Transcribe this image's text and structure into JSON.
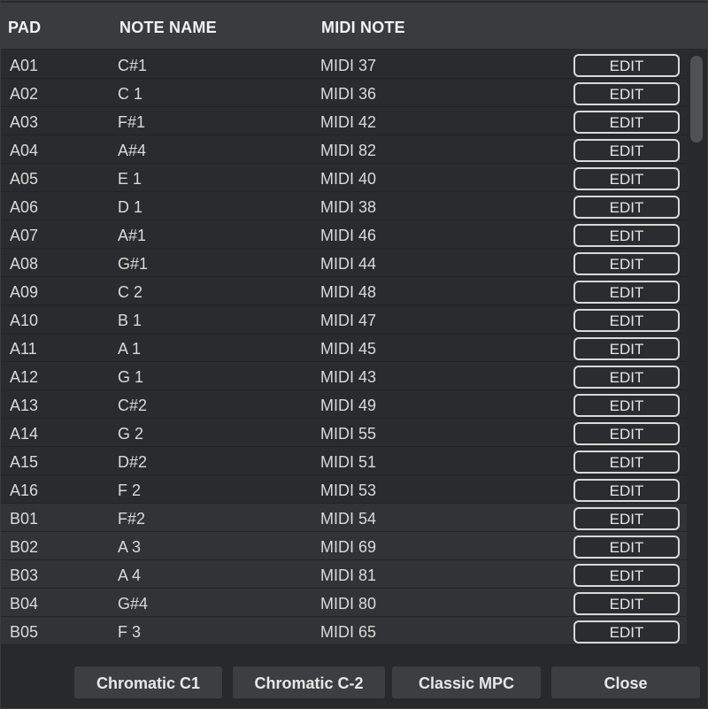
{
  "header": {
    "pad_label": "PAD",
    "note_name_label": "NOTE NAME",
    "midi_note_label": "MIDI NOTE"
  },
  "edit_label": "EDIT",
  "rows": [
    {
      "pad": "A01",
      "note": "C#1",
      "midi": "MIDI 37"
    },
    {
      "pad": "A02",
      "note": "C 1",
      "midi": "MIDI 36"
    },
    {
      "pad": "A03",
      "note": "F#1",
      "midi": "MIDI 42"
    },
    {
      "pad": "A04",
      "note": "A#4",
      "midi": "MIDI 82"
    },
    {
      "pad": "A05",
      "note": "E 1",
      "midi": "MIDI 40"
    },
    {
      "pad": "A06",
      "note": "D 1",
      "midi": "MIDI 38"
    },
    {
      "pad": "A07",
      "note": "A#1",
      "midi": "MIDI 46"
    },
    {
      "pad": "A08",
      "note": "G#1",
      "midi": "MIDI 44"
    },
    {
      "pad": "A09",
      "note": "C 2",
      "midi": "MIDI 48"
    },
    {
      "pad": "A10",
      "note": "B 1",
      "midi": "MIDI 47"
    },
    {
      "pad": "A11",
      "note": "A 1",
      "midi": "MIDI 45"
    },
    {
      "pad": "A12",
      "note": "G 1",
      "midi": "MIDI 43"
    },
    {
      "pad": "A13",
      "note": "C#2",
      "midi": "MIDI 49"
    },
    {
      "pad": "A14",
      "note": "G 2",
      "midi": "MIDI 55"
    },
    {
      "pad": "A15",
      "note": "D#2",
      "midi": "MIDI 51"
    },
    {
      "pad": "A16",
      "note": "F 2",
      "midi": "MIDI 53"
    },
    {
      "pad": "B01",
      "note": "F#2",
      "midi": "MIDI 54"
    },
    {
      "pad": "B02",
      "note": "A 3",
      "midi": "MIDI 69"
    },
    {
      "pad": "B03",
      "note": "A 4",
      "midi": "MIDI 81"
    },
    {
      "pad": "B04",
      "note": "G#4",
      "midi": "MIDI 80"
    },
    {
      "pad": "B05",
      "note": "F 3",
      "midi": "MIDI 65"
    }
  ],
  "footer": {
    "chromatic_c1": "Chromatic C1",
    "chromatic_c_minus2": "Chromatic C-2",
    "classic_mpc": "Classic MPC",
    "close": "Close"
  }
}
